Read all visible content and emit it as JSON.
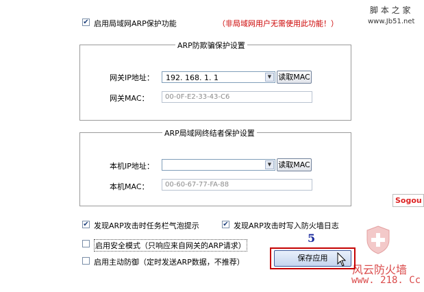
{
  "top": {
    "enable_arp_label": "启用局域网ARP保护功能",
    "enable_arp_checked": true,
    "warning": "（非局域网用户无需使用此功能！）"
  },
  "watermark": {
    "site_name": "脚 本 之 家",
    "site_url": "www.Jb51.net",
    "bottom_text": "风云防火墙",
    "bottom_url": "www. 218. Cc"
  },
  "gateway_group": {
    "title": "ARP防欺骗保护设置",
    "ip_label": "网关IP地址：",
    "ip_value": "192. 168. 1. 1",
    "read_mac_label": "读取MAC",
    "mac_label": "网关MAC：",
    "mac_value": "00-0F-E2-33-43-C6"
  },
  "local_group": {
    "title": "ARP局域网终结者保护设置",
    "ip_label": "本机IP地址：",
    "ip_value": "",
    "read_mac_label": "读取MAC",
    "mac_label": "本机MAC：",
    "mac_value": "00-60-67-77-FA-88"
  },
  "options": {
    "balloon_label": "发现ARP攻击时任务栏气泡提示",
    "balloon_checked": true,
    "log_label": "发现ARP攻击时写入防火墙日志",
    "log_checked": true,
    "safe_mode_label": "启用安全模式（只响应来自网关的ARP请求）",
    "safe_mode_checked": false,
    "active_defense_label": "启用主动防御（定时发送ARP数据，不推荐）",
    "active_defense_checked": false
  },
  "step_number": "5",
  "save_button_label": "保存应用",
  "sogou_logo": "Sogou",
  "colors": {
    "warning": "#cc0000",
    "step": "#1a2a9c",
    "highlight": "#c40000",
    "watermark": "#d42b2b"
  }
}
